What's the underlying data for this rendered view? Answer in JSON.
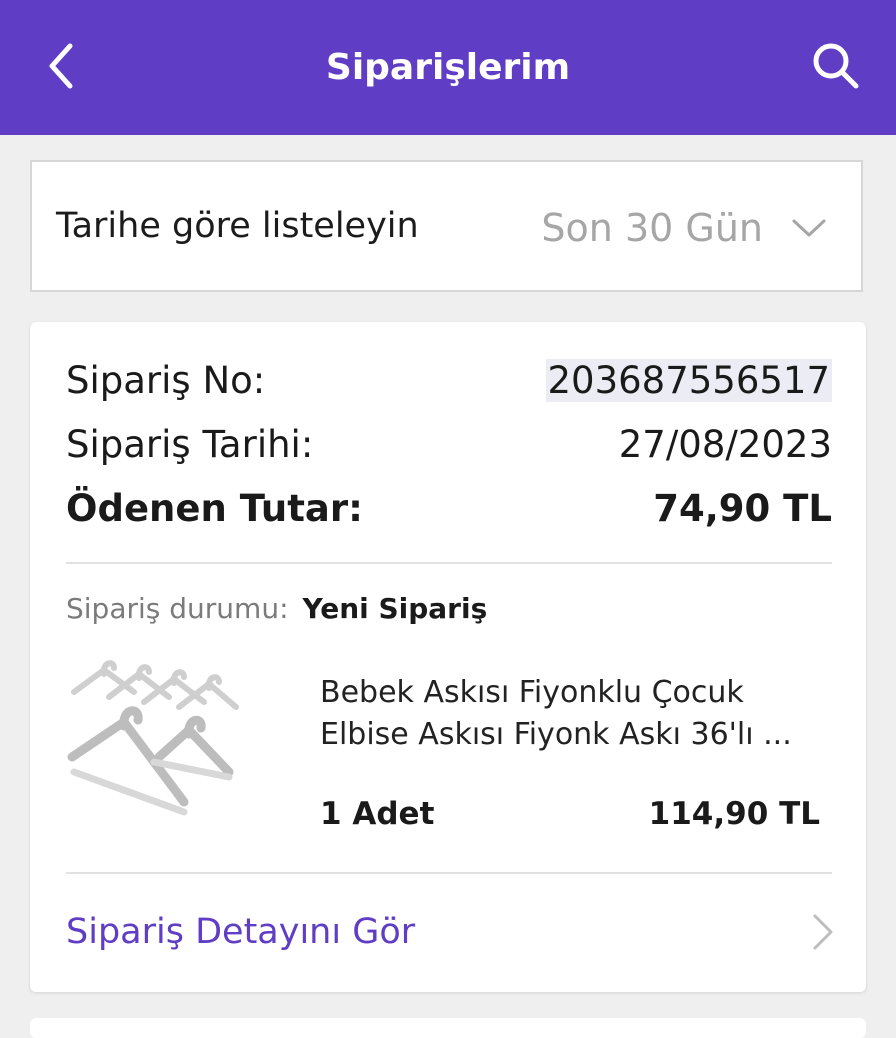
{
  "header": {
    "title": "Siparişlerim",
    "back_icon": "chevron-left-icon",
    "search_icon": "search-icon",
    "background_color": "#5f3dc4"
  },
  "filter": {
    "label": "Tarihe göre listeleyin",
    "selected": "Son 30 Gün",
    "dropdown_icon": "chevron-down-icon"
  },
  "order": {
    "number_label": "Sipariş No:",
    "number": "203687556517",
    "date_label": "Sipariş Tarihi:",
    "date": "27/08/2023",
    "paid_label": "Ödenen Tutar:",
    "paid": "74,90 TL",
    "status_label": "Sipariş durumu:",
    "status": "Yeni Sipariş",
    "product": {
      "name": "Bebek Askısı Fiyonklu Çocuk Elbise Askısı Fiyonk Askı 36'lı ...",
      "quantity": "1 Adet",
      "price": "114,90 TL",
      "image_icon": "hanger-product-image"
    },
    "detail_link": "Sipariş Detayını Gör",
    "detail_icon": "chevron-right-icon"
  }
}
